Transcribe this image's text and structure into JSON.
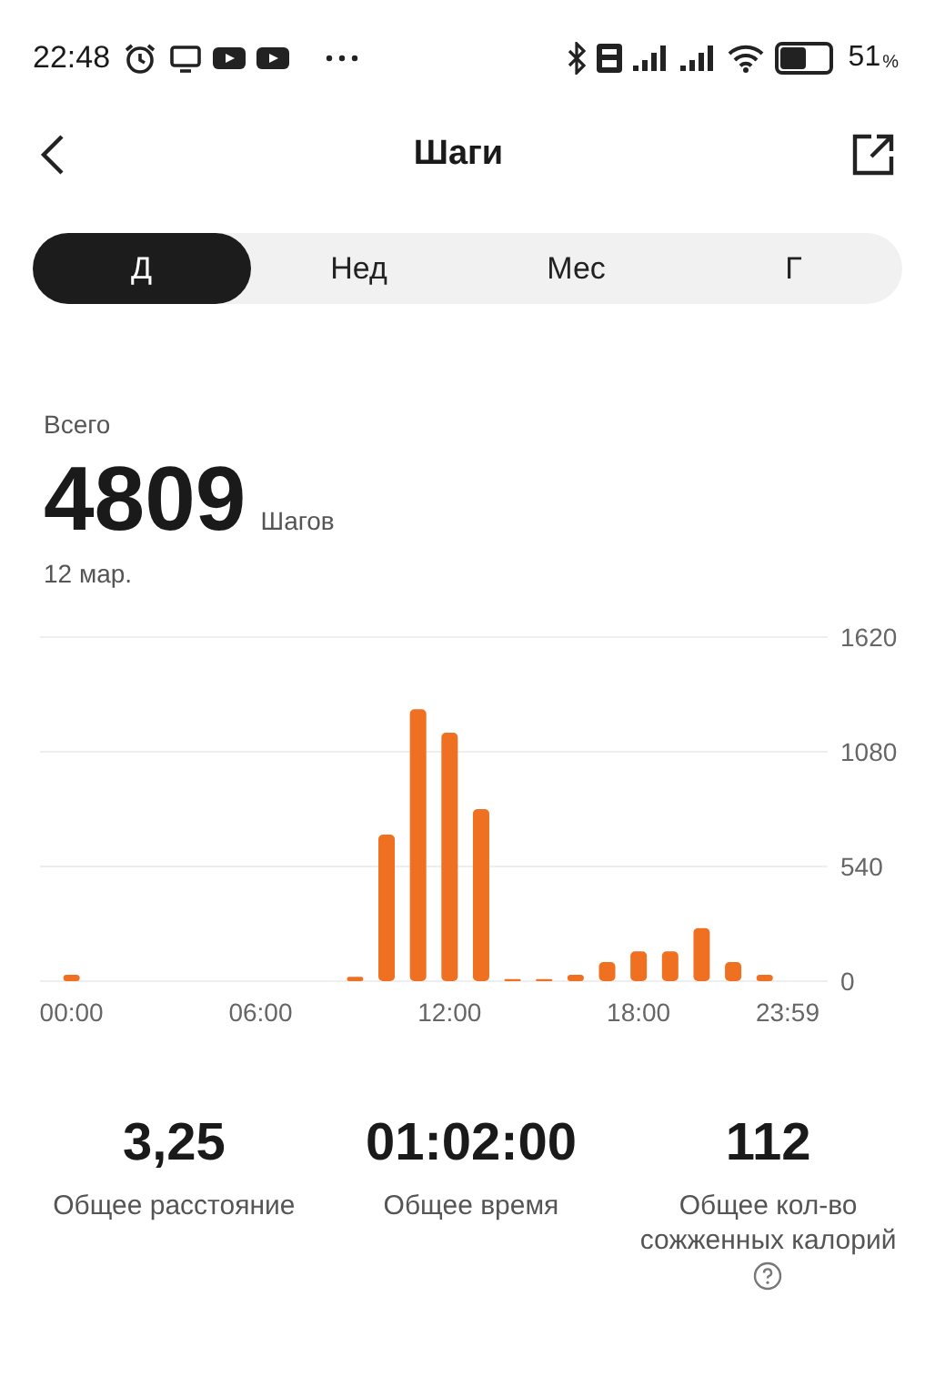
{
  "status_bar": {
    "time": "22:48",
    "battery": {
      "level": 0.51,
      "percent": "51",
      "unit": "%"
    }
  },
  "header": {
    "title": "Шаги"
  },
  "tabs": [
    {
      "label": "Д",
      "selected": true
    },
    {
      "label": "Нед",
      "selected": false
    },
    {
      "label": "Мес",
      "selected": false
    },
    {
      "label": "Г",
      "selected": false
    }
  ],
  "summary": {
    "caption": "Всего",
    "value": "4809",
    "unit": "Шагов",
    "date": "12 мар."
  },
  "chart_data": {
    "type": "bar",
    "x": [
      0,
      1,
      2,
      3,
      4,
      5,
      6,
      7,
      8,
      9,
      10,
      11,
      12,
      13,
      14,
      15,
      16,
      17,
      18,
      19,
      20,
      21,
      22,
      23
    ],
    "values": [
      30,
      0,
      0,
      0,
      0,
      0,
      0,
      0,
      0,
      20,
      690,
      1280,
      1170,
      810,
      10,
      10,
      30,
      90,
      140,
      140,
      250,
      90,
      30,
      0
    ],
    "xlim": [
      -1,
      24
    ],
    "ylim": [
      0,
      1620
    ],
    "yticks": [
      0,
      540,
      1080,
      1620
    ],
    "xticks": [
      {
        "value": 0,
        "label": "00:00"
      },
      {
        "value": 6,
        "label": "06:00"
      },
      {
        "value": 12,
        "label": "12:00"
      },
      {
        "value": 18,
        "label": "18:00"
      },
      {
        "value": 23.98,
        "label": "23:59"
      }
    ]
  },
  "stats": [
    {
      "value": "3,25",
      "label": "Общее расстояние",
      "help": false
    },
    {
      "value": "01:02:00",
      "label": "Общее время",
      "help": false
    },
    {
      "value": "112",
      "label": "Общее кол-во сожженных калорий",
      "help": true
    }
  ]
}
